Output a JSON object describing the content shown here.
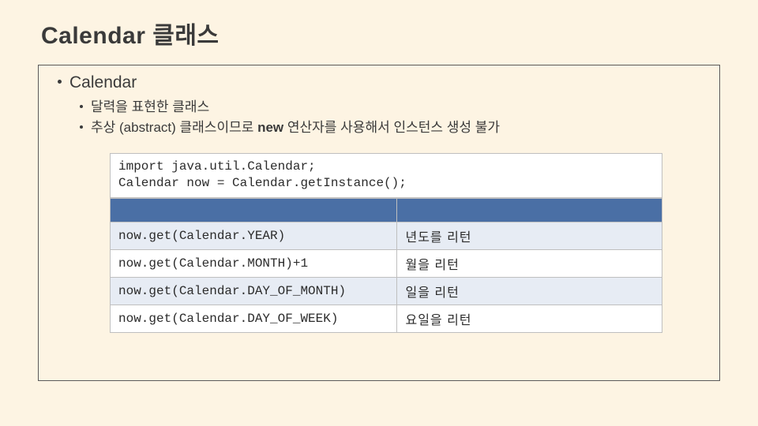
{
  "title": "Calendar 클래스",
  "section_heading": "Calendar",
  "bullets": [
    "달력을 표현한 클래스",
    "추상 (abstract) 클래스이므로 new 연산자를 사용해서 인스턴스 생성 불가"
  ],
  "bullet2_strong_word": "new",
  "code_lines": "import java.util.Calendar;\nCalendar now = Calendar.getInstance();",
  "table": {
    "rows": [
      {
        "code": "now.get(Calendar.YEAR)",
        "desc": "년도를 리턴"
      },
      {
        "code": "now.get(Calendar.MONTH)+1",
        "desc": "월을 리턴"
      },
      {
        "code": "now.get(Calendar.DAY_OF_MONTH)",
        "desc": "일을 리턴"
      },
      {
        "code": "now.get(Calendar.DAY_OF_WEEK)",
        "desc": "요일을 리턴"
      }
    ]
  }
}
